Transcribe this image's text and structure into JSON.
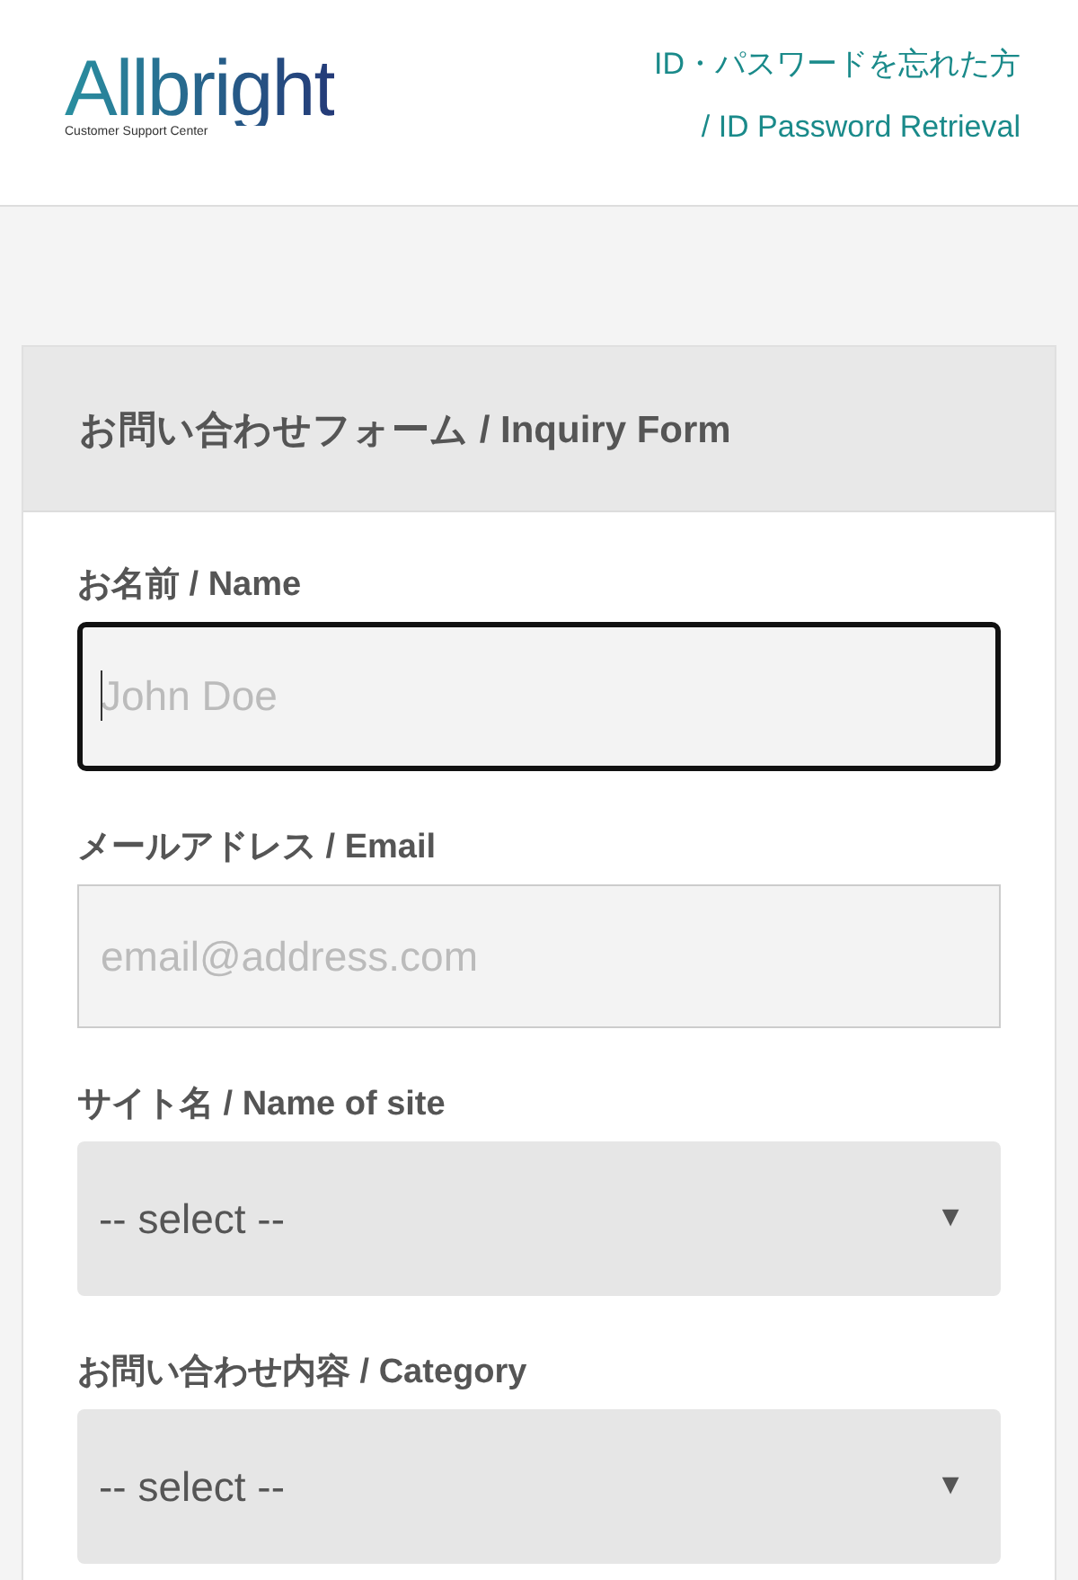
{
  "header": {
    "logo": {
      "name": "Allbright",
      "tagline": "Customer Support Center"
    },
    "retrieval_link": [
      "ID・パスワードを忘れた方",
      "/ ID Password Retrieval"
    ]
  },
  "form": {
    "title": "お問い合わせフォーム / Inquiry Form",
    "fields": [
      {
        "kind": "text",
        "label": "お名前 / Name",
        "placeholder": "John Doe",
        "focused": true
      },
      {
        "kind": "text",
        "label": "メールアドレス / Email",
        "placeholder": "email@address.com",
        "focused": false
      },
      {
        "kind": "select",
        "label": "サイト名 / Name of site",
        "value": "-- select --",
        "arrow": "▼"
      },
      {
        "kind": "select",
        "label": "お問い合わせ内容 / Category",
        "value": "-- select --",
        "arrow": "▼"
      }
    ]
  }
}
